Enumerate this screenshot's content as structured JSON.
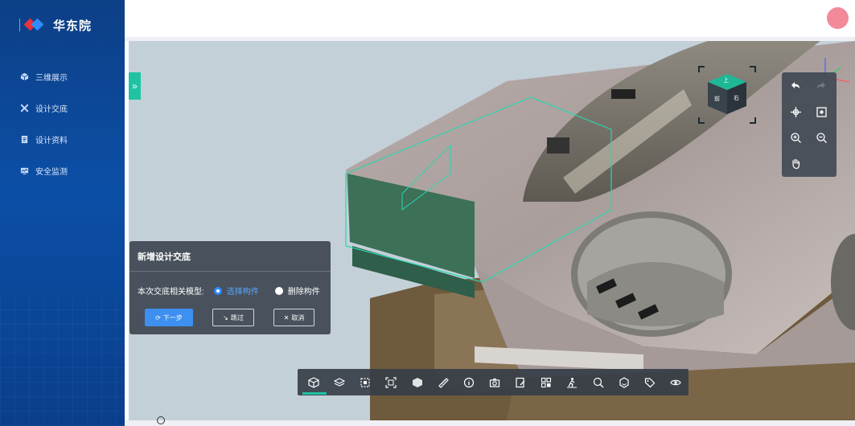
{
  "app": {
    "brand_name": "华东院"
  },
  "sidebar": {
    "items": [
      {
        "label": "三维展示",
        "icon": "cube-icon"
      },
      {
        "label": "设计交底",
        "icon": "tools-icon"
      },
      {
        "label": "设计资料",
        "icon": "document-icon"
      },
      {
        "label": "安全监测",
        "icon": "monitor-icon"
      }
    ]
  },
  "header": {
    "avatar_color": "#f28a9a"
  },
  "viewcube": {
    "face_label": "上",
    "side_label": "前",
    "right_label": "右"
  },
  "dialog": {
    "title": "新增设计交底",
    "field_label": "本次交底相关模型:",
    "options": [
      {
        "label": "选择构件",
        "selected": true
      },
      {
        "label": "删除构件",
        "selected": false
      }
    ],
    "buttons": {
      "next": "下一步",
      "skip": "跳过",
      "cancel": "取消"
    }
  },
  "toolbar": {
    "tools": [
      "home-view-icon",
      "layers-icon",
      "section-box-icon",
      "fit-selection-icon",
      "model-tree-icon",
      "measure-icon",
      "properties-icon",
      "snapshot-icon",
      "markup-icon",
      "grid-view-icon",
      "walkthrough-icon",
      "explode-icon",
      "isolate-icon",
      "tag-icon",
      "visibility-icon"
    ],
    "active_index": 0
  },
  "colors": {
    "accent": "#1fc3a3",
    "primary": "#3d8ff0",
    "sidebar": "#0b4fa6"
  }
}
